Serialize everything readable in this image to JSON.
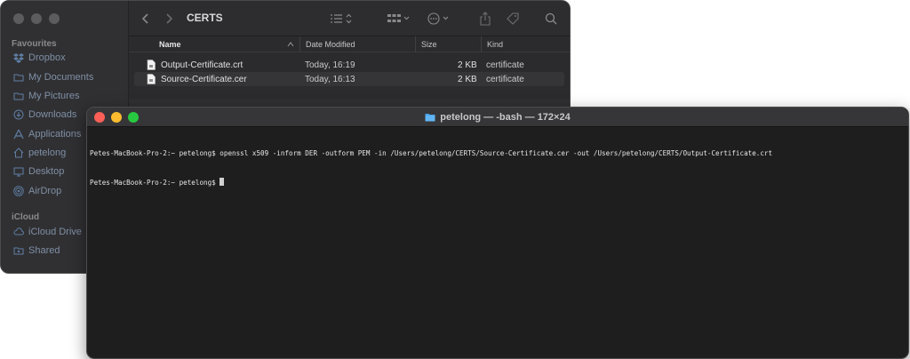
{
  "finder": {
    "folder_title": "CERTS",
    "sidebar": {
      "favourites_heading": "Favourites",
      "favourites": [
        {
          "label": "Dropbox",
          "icon": "dropbox-icon"
        },
        {
          "label": "My Documents",
          "icon": "folder-icon"
        },
        {
          "label": "My Pictures",
          "icon": "folder-icon"
        },
        {
          "label": "Downloads",
          "icon": "download-icon"
        },
        {
          "label": "Applications",
          "icon": "applications-icon"
        },
        {
          "label": "petelong",
          "icon": "home-icon"
        },
        {
          "label": "Desktop",
          "icon": "desktop-icon"
        },
        {
          "label": "AirDrop",
          "icon": "airdrop-icon"
        }
      ],
      "icloud_heading": "iCloud",
      "icloud": [
        {
          "label": "iCloud Drive",
          "icon": "cloud-icon"
        },
        {
          "label": "Shared",
          "icon": "shared-folder-icon"
        }
      ]
    },
    "columns": {
      "name": "Name",
      "date_modified": "Date Modified",
      "size": "Size",
      "kind": "Kind"
    },
    "files": [
      {
        "name": "Output-Certificate.crt",
        "date": "Today, 16:19",
        "size": "2 KB",
        "kind": "certificate"
      },
      {
        "name": "Source-Certificate.cer",
        "date": "Today, 16:13",
        "size": "2 KB",
        "kind": "certificate"
      }
    ],
    "colors": {
      "sidebar_text": "#7f8fa4",
      "background": "#2b2b2d"
    }
  },
  "terminal": {
    "title": "petelong — -bash — 172×24",
    "lines": [
      "Petes-MacBook-Pro-2:~ petelong$ openssl x509 -inform DER -outform PEM -in /Users/petelong/CERTS/Source-Certificate.cer -out /Users/petelong/CERTS/Output-Certificate.crt",
      "Petes-MacBook-Pro-2:~ petelong$ "
    ],
    "colors": {
      "close": "#ff5f57",
      "minimize": "#febc2e",
      "zoom": "#28c840",
      "background": "#1e1e1e"
    }
  }
}
